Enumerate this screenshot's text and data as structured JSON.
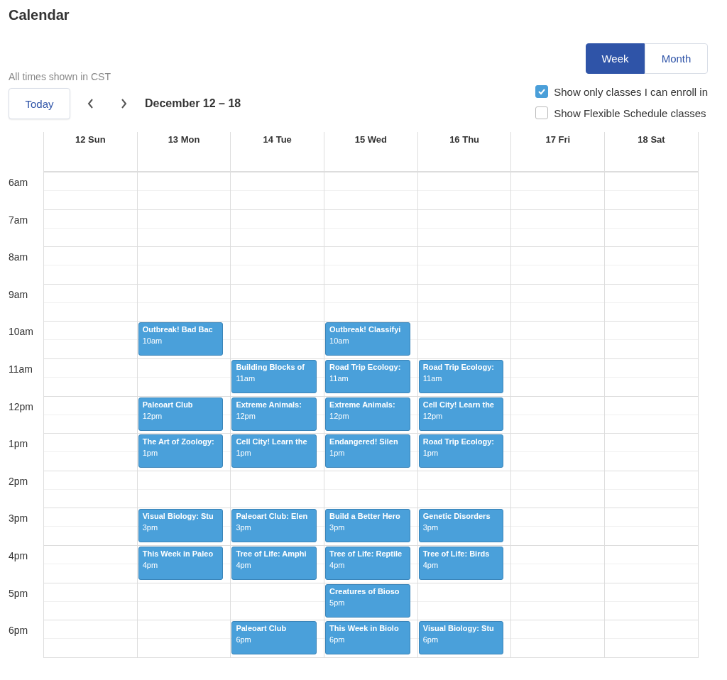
{
  "title": "Calendar",
  "view_toggle": [
    {
      "label": "Week",
      "selected": true
    },
    {
      "label": "Month",
      "selected": false
    }
  ],
  "timezone_note": "All times shown in CST",
  "today_button": "Today",
  "date_range": "December 12 – 18",
  "filters": [
    {
      "label": "Show only classes I can enroll in",
      "checked": true
    },
    {
      "label": "Show Flexible Schedule classes",
      "checked": false
    }
  ],
  "days": [
    "12 Sun",
    "13 Mon",
    "14 Tue",
    "15 Wed",
    "16 Thu",
    "17 Fri",
    "18 Sat"
  ],
  "rows": [
    {
      "label": "6am",
      "slots": [
        {
          "kind": "empty"
        },
        {
          "kind": "empty"
        },
        {
          "kind": "empty"
        },
        {
          "kind": "empty"
        },
        {
          "kind": "empty"
        },
        {
          "kind": "empty"
        },
        {
          "kind": "empty"
        }
      ]
    },
    {
      "label": "7am",
      "slots": [
        {
          "kind": "empty"
        },
        {
          "kind": "empty"
        },
        {
          "kind": "empty"
        },
        {
          "kind": "empty"
        },
        {
          "kind": "empty"
        },
        {
          "kind": "empty"
        },
        {
          "kind": "empty"
        }
      ]
    },
    {
      "label": "8am",
      "slots": [
        {
          "kind": "empty"
        },
        {
          "kind": "empty"
        },
        {
          "kind": "empty"
        },
        {
          "kind": "empty"
        },
        {
          "kind": "empty"
        },
        {
          "kind": "empty"
        },
        {
          "kind": "empty"
        }
      ]
    },
    {
      "label": "9am",
      "slots": [
        {
          "kind": "empty"
        },
        {
          "kind": "empty"
        },
        {
          "kind": "empty"
        },
        {
          "kind": "empty"
        },
        {
          "kind": "empty"
        },
        {
          "kind": "empty"
        },
        {
          "kind": "empty"
        }
      ]
    },
    {
      "label": "10am",
      "slots": [
        {
          "kind": "empty"
        },
        {
          "kind": "event",
          "title": "Outbreak! Bad Bac",
          "time": "10am"
        },
        {
          "kind": "empty"
        },
        {
          "kind": "event",
          "title": "Outbreak! Classifyi",
          "time": "10am"
        },
        {
          "kind": "empty"
        },
        {
          "kind": "empty"
        },
        {
          "kind": "empty"
        }
      ]
    },
    {
      "label": "11am",
      "slots": [
        {
          "kind": "empty"
        },
        {
          "kind": "empty"
        },
        {
          "kind": "event",
          "title": "Building Blocks of",
          "time": "11am"
        },
        {
          "kind": "event",
          "title": "Road Trip Ecology:",
          "time": "11am"
        },
        {
          "kind": "event",
          "title": "Road Trip Ecology:",
          "time": "11am"
        },
        {
          "kind": "empty"
        },
        {
          "kind": "empty"
        }
      ]
    },
    {
      "label": "12pm",
      "slots": [
        {
          "kind": "empty"
        },
        {
          "kind": "event",
          "title": "Paleoart Club",
          "time": "12pm"
        },
        {
          "kind": "event",
          "title": "Extreme Animals:",
          "time": "12pm"
        },
        {
          "kind": "event",
          "title": "Extreme Animals:",
          "time": "12pm"
        },
        {
          "kind": "event",
          "title": "Cell City! Learn the",
          "time": "12pm"
        },
        {
          "kind": "empty"
        },
        {
          "kind": "empty"
        }
      ]
    },
    {
      "label": "1pm",
      "slots": [
        {
          "kind": "empty"
        },
        {
          "kind": "event",
          "title": "The Art of Zoology:",
          "time": "1pm"
        },
        {
          "kind": "event",
          "title": "Cell City! Learn the",
          "time": "1pm"
        },
        {
          "kind": "event",
          "title": "Endangered! Silen",
          "time": "1pm"
        },
        {
          "kind": "event",
          "title": "Road Trip Ecology:",
          "time": "1pm"
        },
        {
          "kind": "empty"
        },
        {
          "kind": "empty"
        }
      ]
    },
    {
      "label": "2pm",
      "slots": [
        {
          "kind": "empty"
        },
        {
          "kind": "empty"
        },
        {
          "kind": "empty"
        },
        {
          "kind": "empty"
        },
        {
          "kind": "empty"
        },
        {
          "kind": "empty"
        },
        {
          "kind": "empty"
        }
      ]
    },
    {
      "label": "3pm",
      "slots": [
        {
          "kind": "empty"
        },
        {
          "kind": "event",
          "title": "Visual Biology: Stu",
          "time": "3pm"
        },
        {
          "kind": "event",
          "title": "Paleoart Club: Elen",
          "time": "3pm"
        },
        {
          "kind": "event",
          "title": "Build a Better Hero",
          "time": "3pm"
        },
        {
          "kind": "event",
          "title": "Genetic Disorders",
          "time": "3pm"
        },
        {
          "kind": "empty"
        },
        {
          "kind": "empty"
        }
      ]
    },
    {
      "label": "4pm",
      "slots": [
        {
          "kind": "empty"
        },
        {
          "kind": "event",
          "title": "This Week in Paleo",
          "time": "4pm"
        },
        {
          "kind": "event",
          "title": "Tree of Life: Amphi",
          "time": "4pm"
        },
        {
          "kind": "event",
          "title": "Tree of Life: Reptile",
          "time": "4pm"
        },
        {
          "kind": "event",
          "title": "Tree of Life: Birds",
          "time": "4pm"
        },
        {
          "kind": "empty"
        },
        {
          "kind": "empty"
        }
      ]
    },
    {
      "label": "5pm",
      "slots": [
        {
          "kind": "empty"
        },
        {
          "kind": "empty"
        },
        {
          "kind": "empty"
        },
        {
          "kind": "event",
          "title": "Creatures of Bioso",
          "time": "5pm"
        },
        {
          "kind": "empty"
        },
        {
          "kind": "empty"
        },
        {
          "kind": "empty"
        }
      ]
    },
    {
      "label": "6pm",
      "slots": [
        {
          "kind": "empty"
        },
        {
          "kind": "empty"
        },
        {
          "kind": "event",
          "title": "Paleoart Club",
          "time": "6pm"
        },
        {
          "kind": "event",
          "title": "This Week in Biolo",
          "time": "6pm"
        },
        {
          "kind": "event",
          "title": "Visual Biology: Stu",
          "time": "6pm"
        },
        {
          "kind": "empty"
        },
        {
          "kind": "empty"
        }
      ]
    }
  ]
}
